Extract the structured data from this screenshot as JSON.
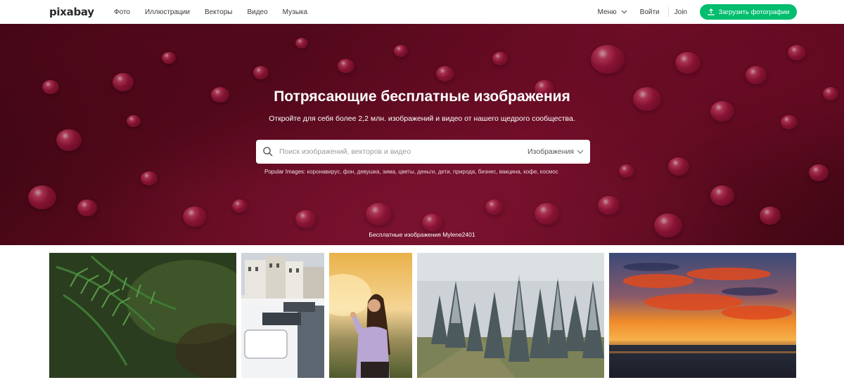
{
  "header": {
    "logo": "pixabay",
    "nav": [
      "Фото",
      "Иллюстрации",
      "Векторы",
      "Видео",
      "Музыка"
    ],
    "menu_label": "Меню",
    "login_label": "Войти",
    "join_label": "Join",
    "upload_label": "Загрузить фотографии"
  },
  "hero": {
    "title": "Потрясающие бесплатные изображения",
    "subtitle": "Откройте для себя более 2,2 млн. изображений и видео от нашего щедрого сообщества.",
    "search_placeholder": "Поиск изображений, векторов и видео",
    "search_type": "Изображения",
    "popular_label": "Popular Images:",
    "popular_tags": [
      "коронавирус",
      "фон",
      "девушка",
      "зима",
      "цветы",
      "деньги",
      "дети",
      "природа",
      "бизнес",
      "вакцина",
      "кофе",
      "космос"
    ],
    "credit": "Бесплатные изображения Mylene2401"
  },
  "colors": {
    "accent": "#02be6e",
    "hero": "#7a0e2b"
  },
  "icons": {
    "search": "search-icon",
    "upload": "upload-icon",
    "chevron": "chevron-down-icon"
  }
}
